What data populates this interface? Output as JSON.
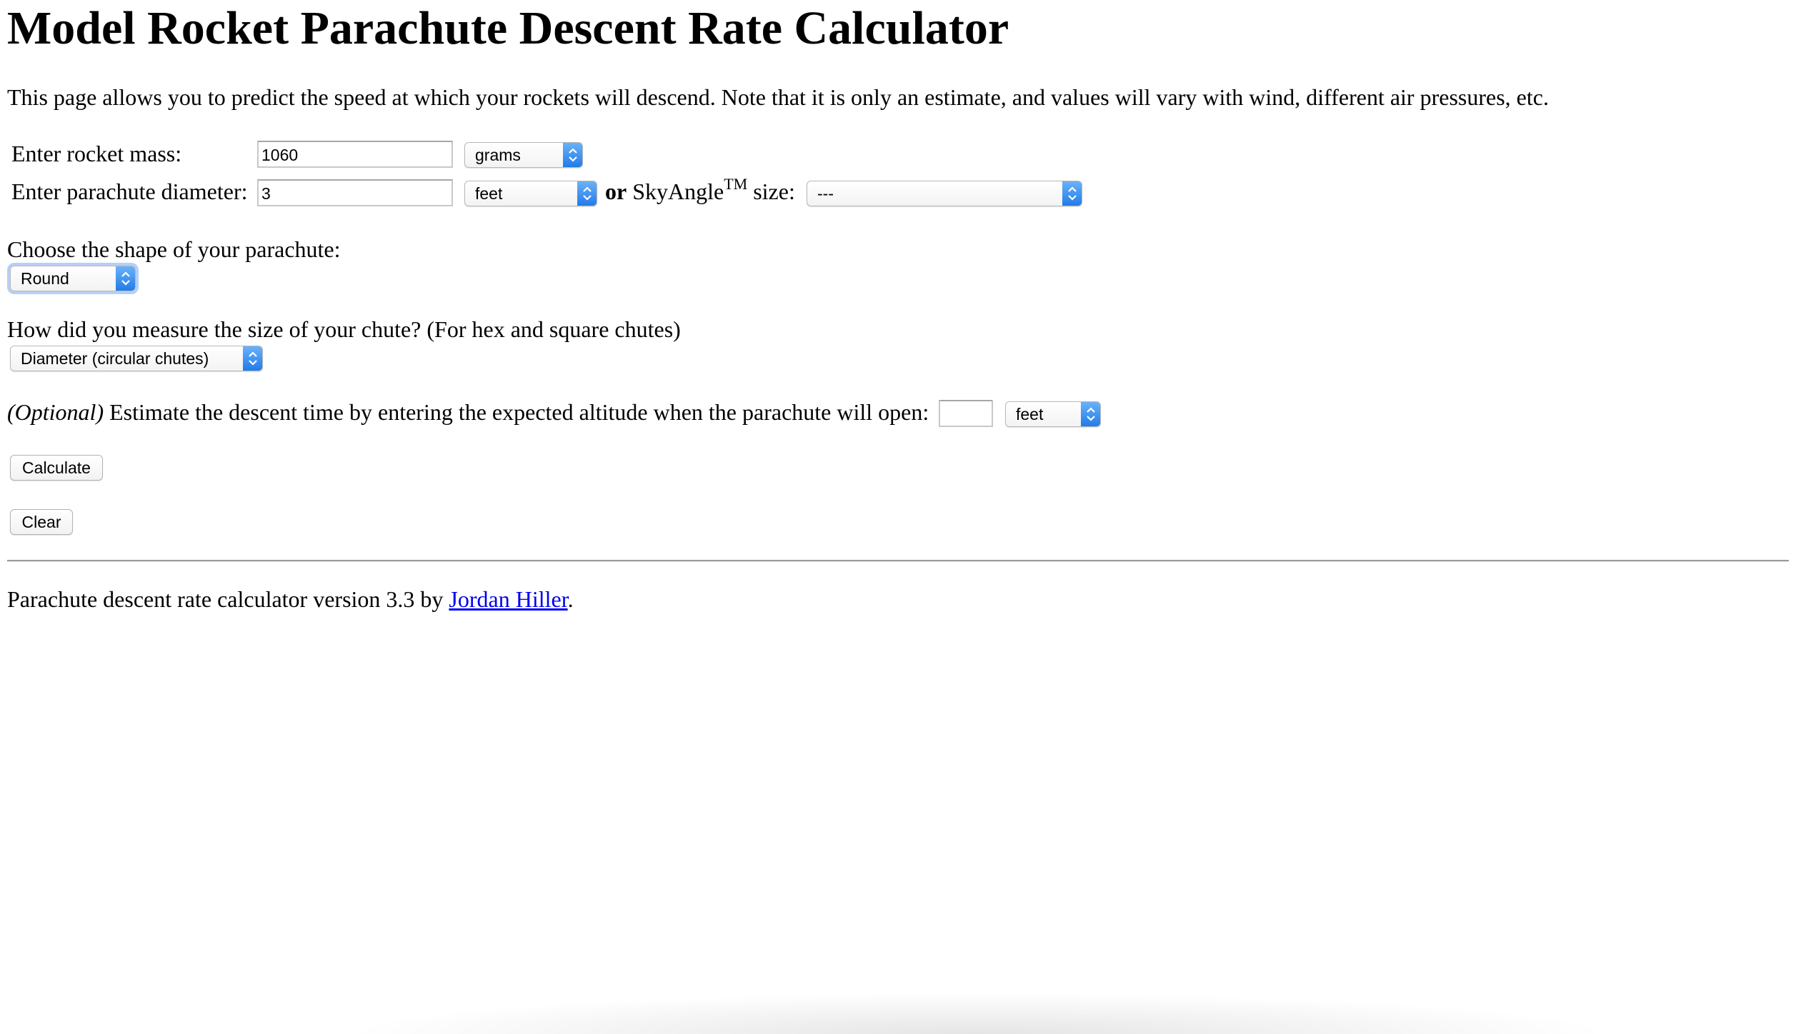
{
  "page": {
    "title": "Model Rocket Parachute Descent Rate Calculator",
    "intro": "This page allows you to predict the speed at which your rockets will descend. Note that it is only an estimate, and values will vary with wind, different air pressures, etc."
  },
  "mass": {
    "label": "Enter rocket mass:",
    "value": "1060",
    "unit": "grams"
  },
  "diameter": {
    "label": "Enter parachute diameter:",
    "value": "3",
    "unit": "feet",
    "or_label": "or",
    "skyangle_label": "SkyAngle",
    "skyangle_tm": "TM",
    "size_label": "size:",
    "skyangle_value": "---"
  },
  "shape": {
    "label": "Choose the shape of your parachute:",
    "value": "Round"
  },
  "measure": {
    "label": "How did you measure the size of your chute? (For hex and square chutes)",
    "value": "Diameter (circular chutes)"
  },
  "altitude": {
    "optional_label": "(Optional)",
    "label": "Estimate the descent time by entering the expected altitude when the parachute will open:",
    "value": "",
    "unit": "feet"
  },
  "buttons": {
    "calculate": "Calculate",
    "clear": "Clear"
  },
  "footer": {
    "text_before": "Parachute descent rate calculator version 3.3 by ",
    "author_link": "Jordan Hiller",
    "text_after": "."
  },
  "colors": {
    "link": "#0000ee",
    "select_arrow_top": "#6cb3fa",
    "select_arrow_bottom": "#1f7ae8"
  },
  "icons": {
    "select_arrow": "chevron-up-down-icon"
  }
}
